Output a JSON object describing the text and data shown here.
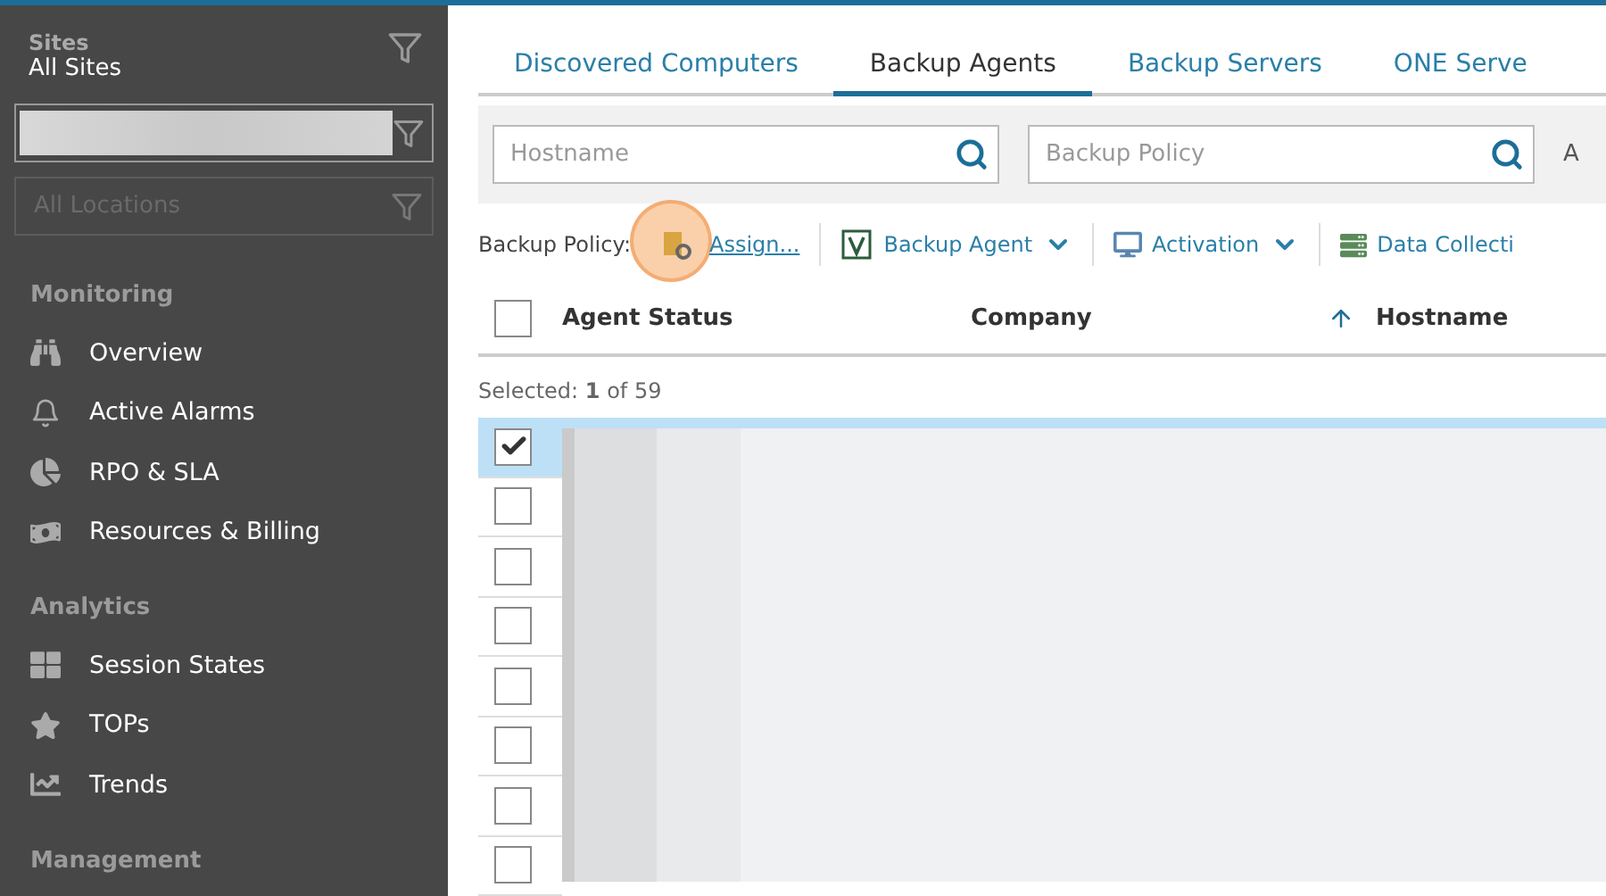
{
  "sidebar": {
    "sites": {
      "label": "Sites",
      "value": "All Sites"
    },
    "locations": {
      "placeholder": "All Locations"
    },
    "sections": [
      {
        "title": "Monitoring",
        "items": [
          {
            "label": "Overview"
          },
          {
            "label": "Active Alarms"
          },
          {
            "label": "RPO & SLA"
          },
          {
            "label": "Resources & Billing"
          }
        ]
      },
      {
        "title": "Analytics",
        "items": [
          {
            "label": "Session States"
          },
          {
            "label": "TOPs"
          },
          {
            "label": "Trends"
          }
        ]
      },
      {
        "title": "Management"
      }
    ]
  },
  "tabs": [
    {
      "label": "Discovered Computers",
      "selected": false
    },
    {
      "label": "Backup Agents",
      "selected": true
    },
    {
      "label": "Backup Servers",
      "selected": false
    },
    {
      "label": "ONE Serve",
      "selected": false
    }
  ],
  "filters": [
    {
      "placeholder": "Hostname"
    },
    {
      "placeholder": "Backup Policy"
    }
  ],
  "filters_cut_label": "A",
  "toolbar": {
    "label": "Backup Policy:",
    "assign": "Assign...",
    "actions": [
      {
        "label": "Backup Agent",
        "dropdown": true
      },
      {
        "label": "Activation",
        "dropdown": true
      },
      {
        "label": "Data Collecti",
        "dropdown": false
      }
    ]
  },
  "table": {
    "all_selected": false,
    "columns": [
      {
        "label": "Agent Status",
        "sorted": false
      },
      {
        "label": "Company",
        "sorted": false
      },
      {
        "label": "Hostname",
        "sorted": true
      }
    ],
    "selection": "Selected: **1** of 59",
    "rows": [
      {
        "selected": true
      },
      {
        "selected": false
      },
      {
        "selected": false
      },
      {
        "selected": false
      },
      {
        "selected": false
      },
      {
        "selected": false
      },
      {
        "selected": false
      },
      {
        "selected": false
      }
    ]
  }
}
